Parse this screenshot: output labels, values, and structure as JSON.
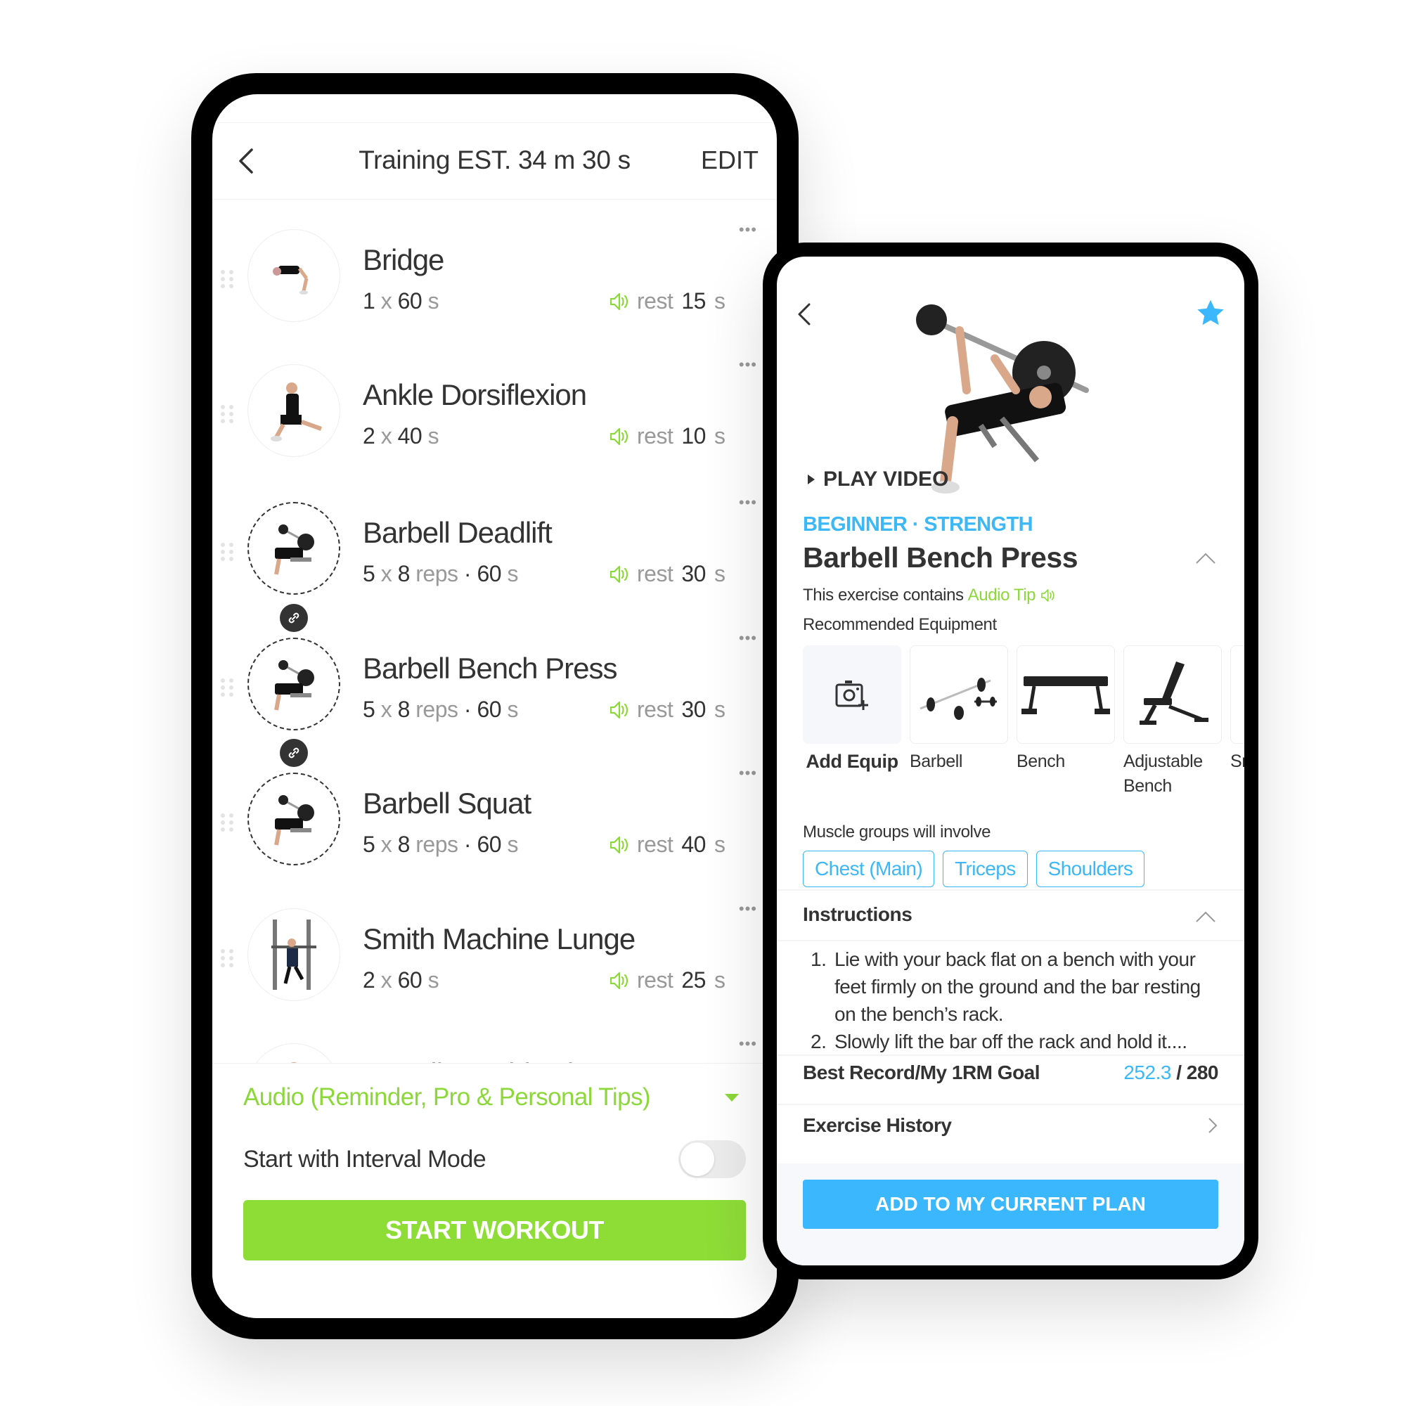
{
  "workout_screen": {
    "title": "Training EST. 34 m 30 s",
    "edit_label": "EDIT",
    "exercises": [
      {
        "name": "Bridge",
        "sets": "1",
        "x": "x",
        "amount": "60",
        "unit": "s",
        "reps_unit": "",
        "duration": "",
        "rest_label": "rest",
        "rest_value": "15",
        "rest_unit": "s",
        "linked": false
      },
      {
        "name": "Ankle Dorsiflexion",
        "sets": "2",
        "x": "x",
        "amount": "40",
        "unit": "s",
        "reps_unit": "",
        "duration": "",
        "rest_label": "rest",
        "rest_value": "10",
        "rest_unit": "s",
        "linked": false
      },
      {
        "name": "Barbell Deadlift",
        "sets": "5",
        "x": "x",
        "amount": "8",
        "unit": "reps",
        "duration": "· 60",
        "duration_unit": "s",
        "rest_label": "rest",
        "rest_value": "30",
        "rest_unit": "s",
        "linked": true
      },
      {
        "name": "Barbell Bench Press",
        "sets": "5",
        "x": "x",
        "amount": "8",
        "unit": "reps",
        "duration": "· 60",
        "duration_unit": "s",
        "rest_label": "rest",
        "rest_value": "30",
        "rest_unit": "s",
        "linked": true
      },
      {
        "name": "Barbell Squat",
        "sets": "5",
        "x": "x",
        "amount": "8",
        "unit": "reps",
        "duration": "· 60",
        "duration_unit": "s",
        "rest_label": "rest",
        "rest_value": "40",
        "rest_unit": "s",
        "linked": true
      },
      {
        "name": "Smith Machine Lunge",
        "sets": "2",
        "x": "x",
        "amount": "60",
        "unit": "s",
        "duration": "",
        "rest_label": "rest",
        "rest_value": "25",
        "rest_unit": "s",
        "linked": false
      },
      {
        "name": "Standing Adduction",
        "linked": false
      }
    ],
    "audio_label": "Audio (Reminder, Pro & Personal Tips)",
    "interval_label": "Start with Interval Mode",
    "interval_enabled": false,
    "start_label": "START WORKOUT"
  },
  "detail_screen": {
    "play_video_label": "PLAY VIDEO",
    "level": "BEGINNER · STRENGTH",
    "title": "Barbell Bench Press",
    "audio_tip_prefix": "This exercise contains",
    "audio_tip_link": "Audio Tip",
    "recommended_label": "Recommended Equipment",
    "equipment": [
      {
        "label": "Add Equip",
        "icon": "camera-add-icon"
      },
      {
        "label": "Barbell",
        "icon": "barbell-icon"
      },
      {
        "label": "Bench",
        "icon": "bench-icon"
      },
      {
        "label": "Adjustable Bench",
        "icon": "adjustable-bench-icon"
      },
      {
        "label": "Sm...",
        "icon": "partial-equipment"
      }
    ],
    "muscle_label": "Muscle groups will involve",
    "muscles": [
      "Chest (Main)",
      "Triceps",
      "Shoulders"
    ],
    "instructions_label": "Instructions",
    "instructions": [
      {
        "num": "1.",
        "text": "Lie with your back flat on a bench with your feet firmly on the ground and the bar resting on the bench’s rack."
      },
      {
        "num": "2.",
        "text": "Slowly lift the bar off the rack and hold it...."
      }
    ],
    "best_record_label": "Best Record/My 1RM Goal",
    "best_record_value": "252.3",
    "goal_value": "/ 280",
    "history_label": "Exercise History",
    "add_plan_label": "ADD TO MY CURRENT PLAN",
    "favorited": true
  },
  "colors": {
    "green": "#8edd37",
    "blue": "#3bb8fd",
    "text": "#333333"
  }
}
